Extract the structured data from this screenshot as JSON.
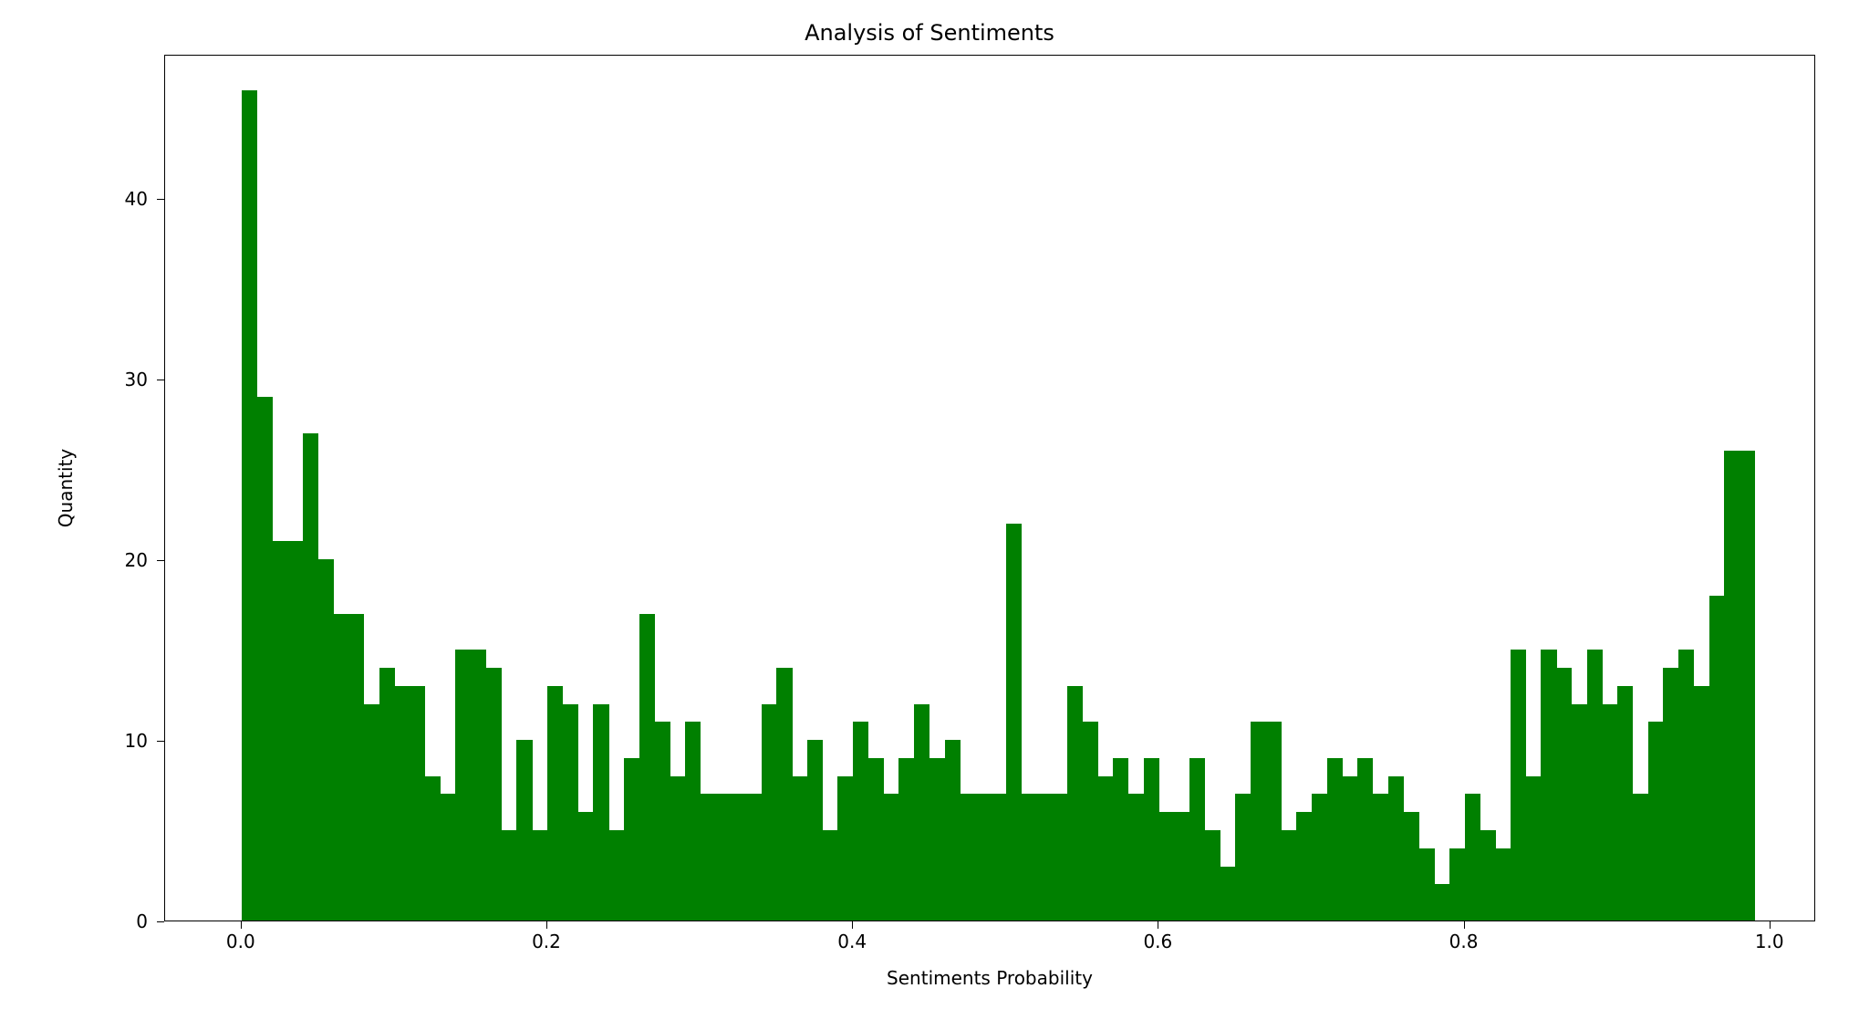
{
  "chart_data": {
    "type": "bar",
    "title": "Analysis of Sentiments",
    "xlabel": "Sentiments Probability",
    "ylabel": "Quantity",
    "bar_color": "#008000",
    "xlim": [
      -0.05,
      1.03
    ],
    "ylim": [
      0,
      48
    ],
    "xticks": [
      0.0,
      0.2,
      0.4,
      0.6,
      0.8,
      1.0
    ],
    "yticks": [
      0,
      10,
      20,
      30,
      40
    ],
    "bin_width": 0.01,
    "categories": [
      0.0,
      0.01,
      0.02,
      0.03,
      0.04,
      0.05,
      0.06,
      0.07,
      0.08,
      0.09,
      0.1,
      0.11,
      0.12,
      0.13,
      0.14,
      0.15,
      0.16,
      0.17,
      0.18,
      0.19,
      0.2,
      0.21,
      0.22,
      0.23,
      0.24,
      0.25,
      0.26,
      0.27,
      0.28,
      0.29,
      0.3,
      0.31,
      0.32,
      0.33,
      0.34,
      0.35,
      0.36,
      0.37,
      0.38,
      0.39,
      0.4,
      0.41,
      0.42,
      0.43,
      0.44,
      0.45,
      0.46,
      0.47,
      0.48,
      0.49,
      0.5,
      0.51,
      0.52,
      0.53,
      0.54,
      0.55,
      0.56,
      0.57,
      0.58,
      0.59,
      0.6,
      0.61,
      0.62,
      0.63,
      0.64,
      0.65,
      0.66,
      0.67,
      0.68,
      0.69,
      0.7,
      0.71,
      0.72,
      0.73,
      0.74,
      0.75,
      0.76,
      0.77,
      0.78,
      0.79,
      0.8,
      0.81,
      0.82,
      0.83,
      0.84,
      0.85,
      0.86,
      0.87,
      0.88,
      0.89,
      0.9,
      0.91,
      0.92,
      0.93,
      0.94,
      0.95,
      0.96,
      0.97,
      0.98
    ],
    "values": [
      46,
      29,
      21,
      21,
      27,
      20,
      17,
      17,
      12,
      14,
      13,
      13,
      8,
      7,
      15,
      15,
      14,
      5,
      10,
      5,
      13,
      12,
      6,
      12,
      5,
      9,
      17,
      11,
      8,
      11,
      7,
      7,
      7,
      7,
      12,
      14,
      8,
      10,
      5,
      8,
      11,
      9,
      7,
      9,
      12,
      9,
      10,
      7,
      7,
      7,
      22,
      7,
      7,
      7,
      13,
      11,
      8,
      9,
      7,
      9,
      6,
      6,
      9,
      5,
      3,
      7,
      11,
      11,
      5,
      6,
      7,
      9,
      8,
      9,
      7,
      8,
      6,
      4,
      2,
      4,
      7,
      5,
      4,
      15,
      8,
      15,
      14,
      12,
      15,
      12,
      13,
      7,
      11,
      14,
      15,
      13,
      18,
      26,
      26
    ]
  }
}
